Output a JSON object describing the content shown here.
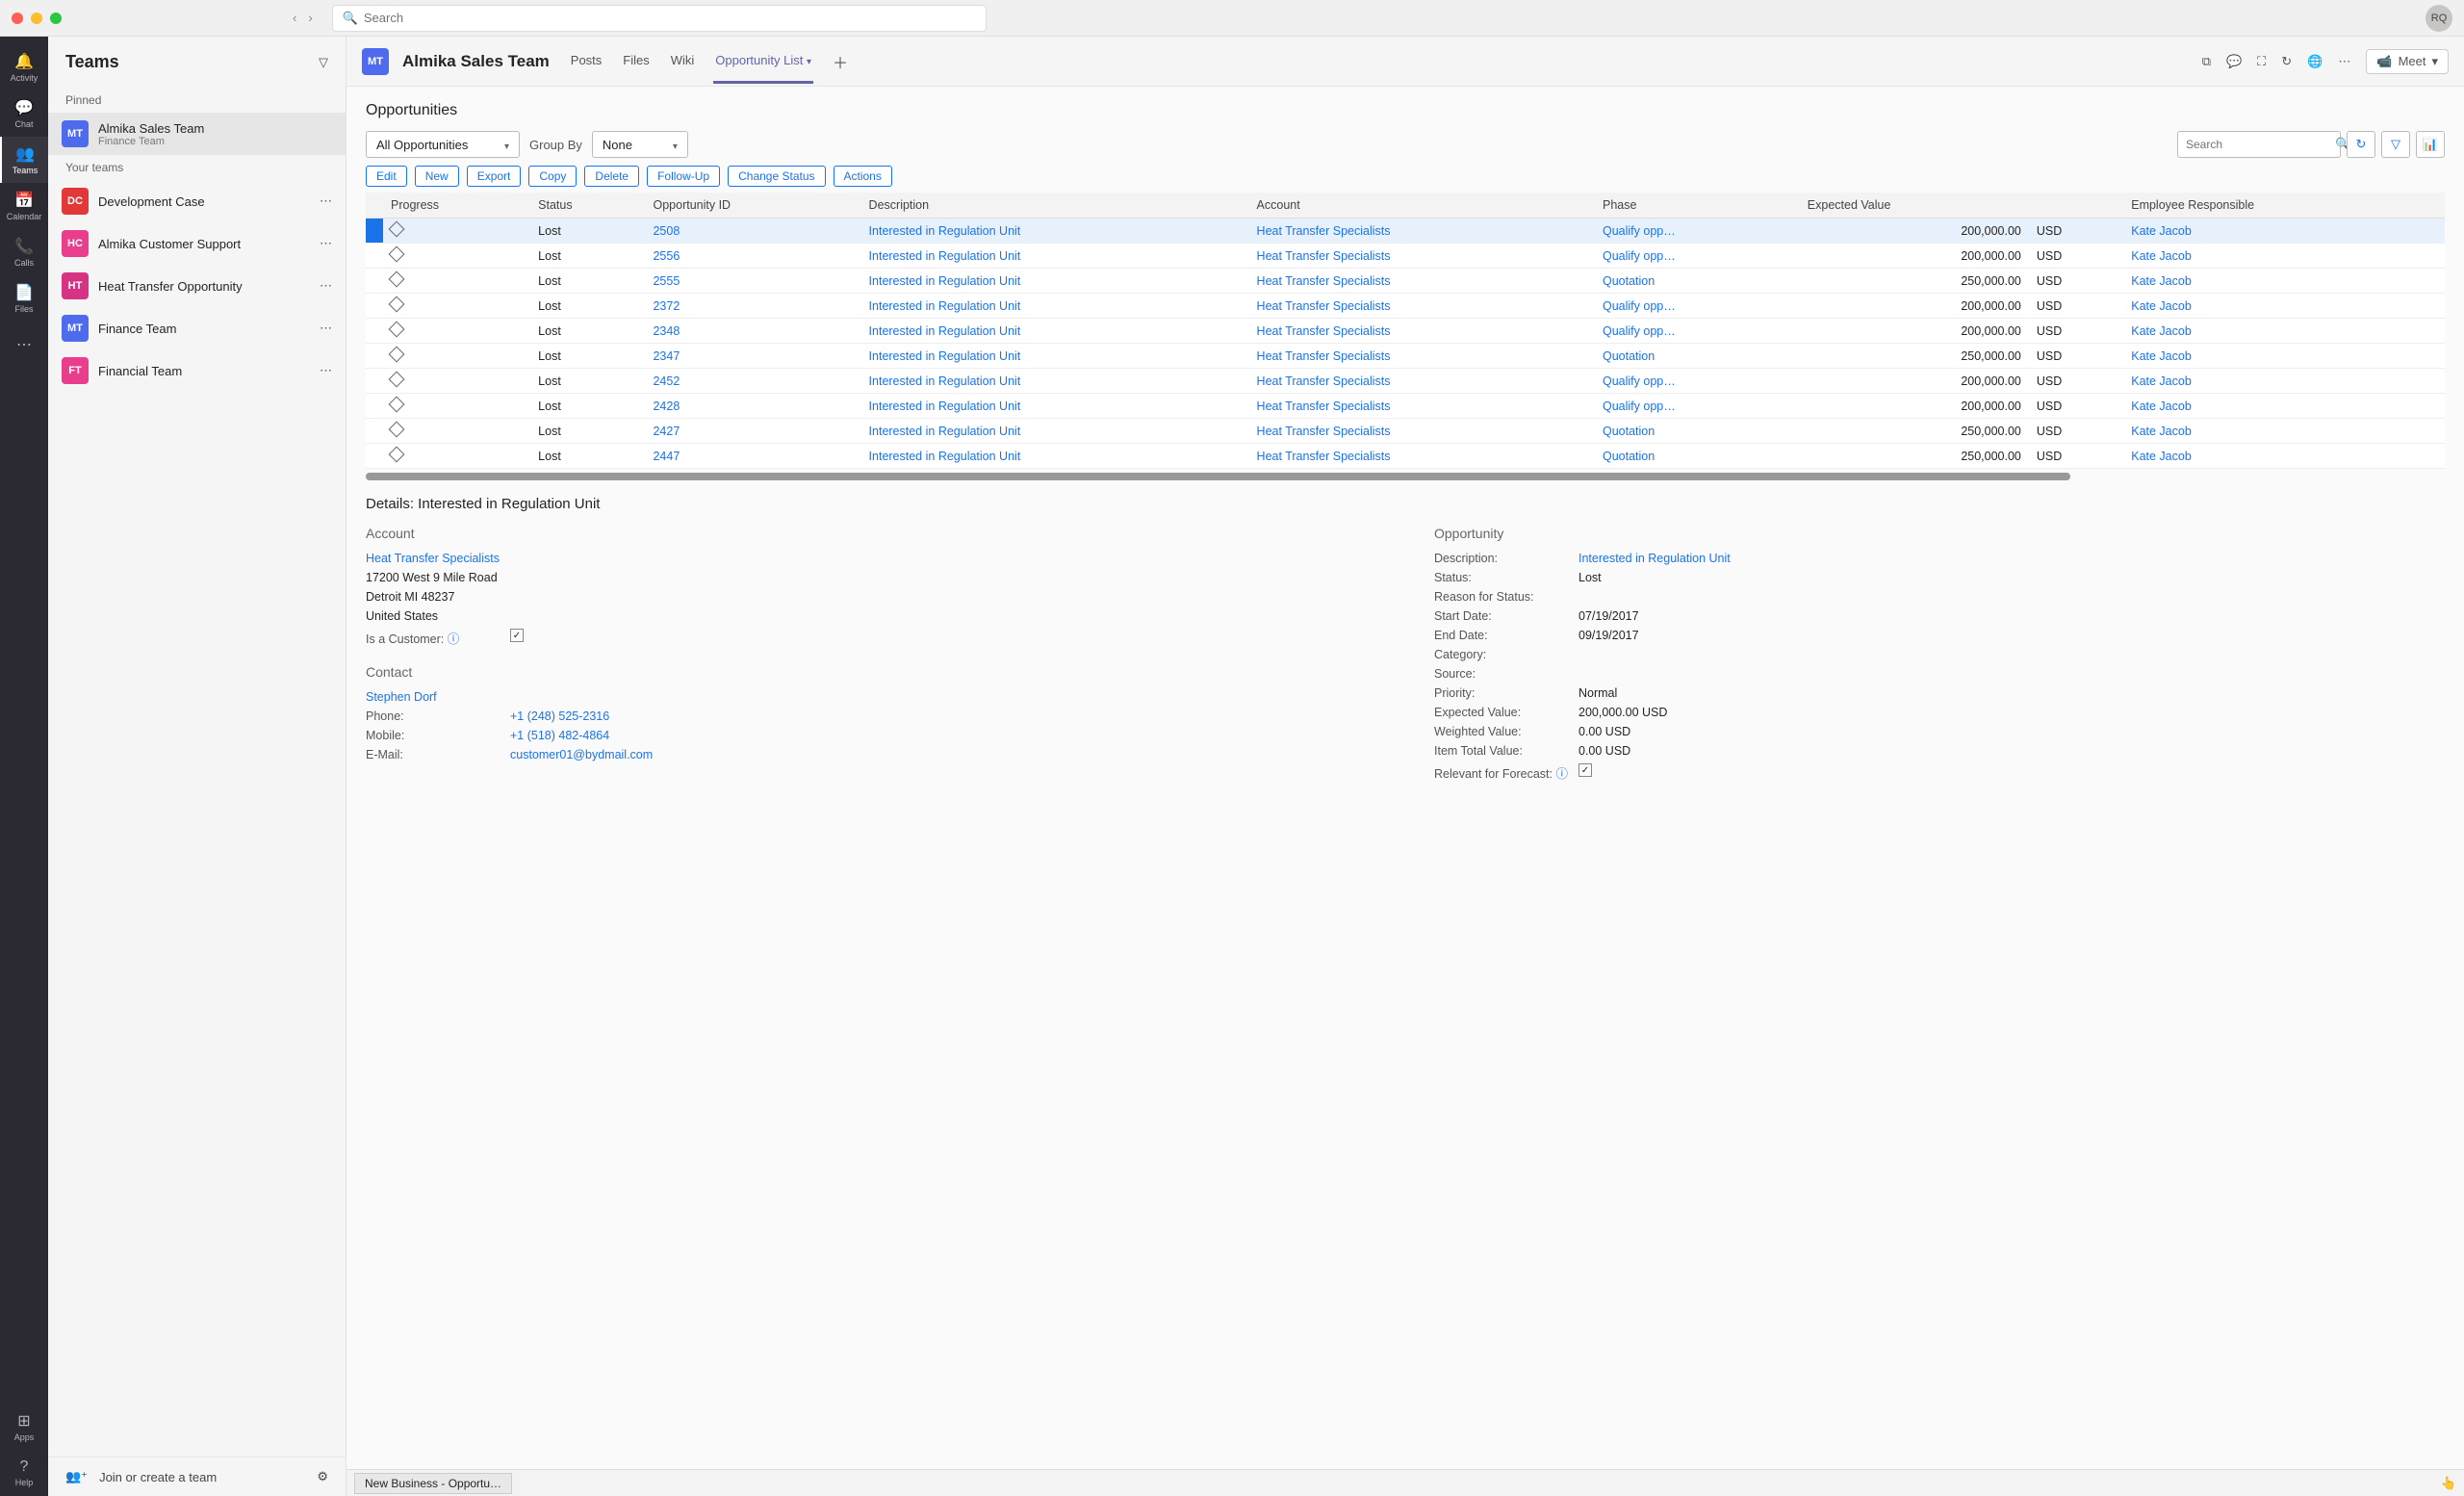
{
  "titlebar": {
    "search_placeholder": "Search",
    "avatar": "RQ"
  },
  "rail": [
    {
      "icon": "🔔",
      "label": "Activity"
    },
    {
      "icon": "💬",
      "label": "Chat"
    },
    {
      "icon": "👥",
      "label": "Teams",
      "active": true
    },
    {
      "icon": "📅",
      "label": "Calendar"
    },
    {
      "icon": "📞",
      "label": "Calls"
    },
    {
      "icon": "📄",
      "label": "Files"
    },
    {
      "icon": "⋯",
      "label": ""
    }
  ],
  "rail_bottom": [
    {
      "icon": "⊞",
      "label": "Apps"
    },
    {
      "icon": "?",
      "label": "Help"
    }
  ],
  "leftpanel": {
    "title": "Teams",
    "pinned_label": "Pinned",
    "pinned": {
      "avatar": "MT",
      "color": "#4f6bed",
      "name": "Almika Sales Team",
      "sub": "Finance Team"
    },
    "your_teams_label": "Your teams",
    "teams": [
      {
        "avatar": "DC",
        "color": "#e23838",
        "name": "Development Case"
      },
      {
        "avatar": "HC",
        "color": "#e83e8c",
        "name": "Almika Customer Support"
      },
      {
        "avatar": "HT",
        "color": "#d63384",
        "name": "Heat Transfer Opportunity"
      },
      {
        "avatar": "MT",
        "color": "#4f6bed",
        "name": "Finance Team"
      },
      {
        "avatar": "FT",
        "color": "#e83e8c",
        "name": "Financial Team"
      }
    ],
    "footer": "Join or create a team"
  },
  "header": {
    "avatar": "MT",
    "title": "Almika Sales Team",
    "tabs": [
      "Posts",
      "Files",
      "Wiki",
      "Opportunity List"
    ],
    "active_tab": 3,
    "meet": "Meet"
  },
  "opp": {
    "title": "Opportunities",
    "filter_dd": "All Opportunities",
    "groupby_label": "Group By",
    "groupby_val": "None",
    "search_placeholder": "Search",
    "actions": [
      "Edit",
      "New",
      "Export",
      "Copy",
      "Delete",
      "Follow-Up",
      "Change Status",
      "Actions"
    ],
    "columns": [
      "Progress",
      "Status",
      "Opportunity ID",
      "Description",
      "Account",
      "Phase",
      "Expected Value",
      "",
      "Employee Responsible"
    ],
    "rows": [
      {
        "status": "Lost",
        "id": "2508",
        "desc": "Interested in Regulation Unit",
        "acct": "Heat Transfer Specialists",
        "phase": "Qualify opp…",
        "val": "200,000.00",
        "cur": "USD",
        "emp": "Kate Jacob",
        "selected": true
      },
      {
        "status": "Lost",
        "id": "2556",
        "desc": "Interested in Regulation Unit",
        "acct": "Heat Transfer Specialists",
        "phase": "Qualify opp…",
        "val": "200,000.00",
        "cur": "USD",
        "emp": "Kate Jacob"
      },
      {
        "status": "Lost",
        "id": "2555",
        "desc": "Interested in Regulation Unit",
        "acct": "Heat Transfer Specialists",
        "phase": "Quotation",
        "val": "250,000.00",
        "cur": "USD",
        "emp": "Kate Jacob"
      },
      {
        "status": "Lost",
        "id": "2372",
        "desc": "Interested in Regulation Unit",
        "acct": "Heat Transfer Specialists",
        "phase": "Qualify opp…",
        "val": "200,000.00",
        "cur": "USD",
        "emp": "Kate Jacob"
      },
      {
        "status": "Lost",
        "id": "2348",
        "desc": "Interested in Regulation Unit",
        "acct": "Heat Transfer Specialists",
        "phase": "Qualify opp…",
        "val": "200,000.00",
        "cur": "USD",
        "emp": "Kate Jacob"
      },
      {
        "status": "Lost",
        "id": "2347",
        "desc": "Interested in Regulation Unit",
        "acct": "Heat Transfer Specialists",
        "phase": "Quotation",
        "val": "250,000.00",
        "cur": "USD",
        "emp": "Kate Jacob"
      },
      {
        "status": "Lost",
        "id": "2452",
        "desc": "Interested in Regulation Unit",
        "acct": "Heat Transfer Specialists",
        "phase": "Qualify opp…",
        "val": "200,000.00",
        "cur": "USD",
        "emp": "Kate Jacob"
      },
      {
        "status": "Lost",
        "id": "2428",
        "desc": "Interested in Regulation Unit",
        "acct": "Heat Transfer Specialists",
        "phase": "Qualify opp…",
        "val": "200,000.00",
        "cur": "USD",
        "emp": "Kate Jacob"
      },
      {
        "status": "Lost",
        "id": "2427",
        "desc": "Interested in Regulation Unit",
        "acct": "Heat Transfer Specialists",
        "phase": "Quotation",
        "val": "250,000.00",
        "cur": "USD",
        "emp": "Kate Jacob"
      },
      {
        "status": "Lost",
        "id": "2447",
        "desc": "Interested in Regulation Unit",
        "acct": "Heat Transfer Specialists",
        "phase": "Quotation",
        "val": "250,000.00",
        "cur": "USD",
        "emp": "Kate Jacob"
      }
    ]
  },
  "details": {
    "title": "Details: Interested in Regulation Unit",
    "account": {
      "heading": "Account",
      "name": "Heat Transfer Specialists",
      "addr1": "17200 West 9 Mile Road",
      "addr2": "Detroit MI  48237",
      "country": "United States",
      "is_customer_label": "Is a Customer:",
      "is_customer": true
    },
    "contact": {
      "heading": "Contact",
      "name": "Stephen Dorf",
      "phone_label": "Phone:",
      "phone": "+1 (248) 525-2316",
      "mobile_label": "Mobile:",
      "mobile": "+1 (518) 482-4864",
      "email_label": "E-Mail:",
      "email": "customer01@bydmail.com"
    },
    "opportunity": {
      "heading": "Opportunity",
      "rows": [
        {
          "label": "Description:",
          "val": "Interested in Regulation Unit",
          "link": true
        },
        {
          "label": "Status:",
          "val": "Lost"
        },
        {
          "label": "Reason for Status:",
          "val": ""
        },
        {
          "label": "Start Date:",
          "val": "07/19/2017"
        },
        {
          "label": "End Date:",
          "val": "09/19/2017"
        },
        {
          "label": "Category:",
          "val": ""
        },
        {
          "label": "Source:",
          "val": ""
        },
        {
          "label": "Priority:",
          "val": "Normal"
        },
        {
          "label": "Expected Value:",
          "val": "200,000.00 USD"
        },
        {
          "label": "Weighted Value:",
          "val": "0.00 USD"
        },
        {
          "label": "Item Total Value:",
          "val": "0.00 USD"
        },
        {
          "label": "Relevant for Forecast:",
          "val": "✓",
          "checkbox": true
        }
      ]
    }
  },
  "bottom_tab": "New Business - Opportu…"
}
